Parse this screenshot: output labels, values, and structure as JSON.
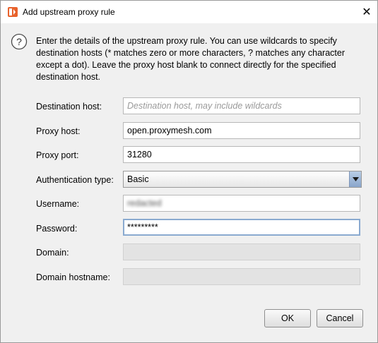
{
  "window": {
    "title": "Add upstream proxy rule",
    "close_glyph": "✕"
  },
  "description": "Enter the details of the upstream proxy rule. You can use wildcards to specify destination hosts (* matches zero or more characters, ? matches any character except a dot). Leave the proxy host blank to connect directly for the specified destination host.",
  "form": {
    "destination_host": {
      "label": "Destination host:",
      "value": "",
      "placeholder": "Destination host, may include wildcards"
    },
    "proxy_host": {
      "label": "Proxy host:",
      "value": "open.proxymesh.com"
    },
    "proxy_port": {
      "label": "Proxy port:",
      "value": "31280"
    },
    "auth_type": {
      "label": "Authentication type:",
      "value": "Basic"
    },
    "username": {
      "label": "Username:",
      "value": "redacted"
    },
    "password": {
      "label": "Password:",
      "value": "*********"
    },
    "domain": {
      "label": "Domain:",
      "value": ""
    },
    "domain_hostname": {
      "label": "Domain hostname:",
      "value": ""
    }
  },
  "buttons": {
    "ok": "OK",
    "cancel": "Cancel"
  },
  "colors": {
    "brand_icon": "#e8622c",
    "dialog_bg": "#f0f0f0",
    "focus_border": "#8aaad0"
  }
}
